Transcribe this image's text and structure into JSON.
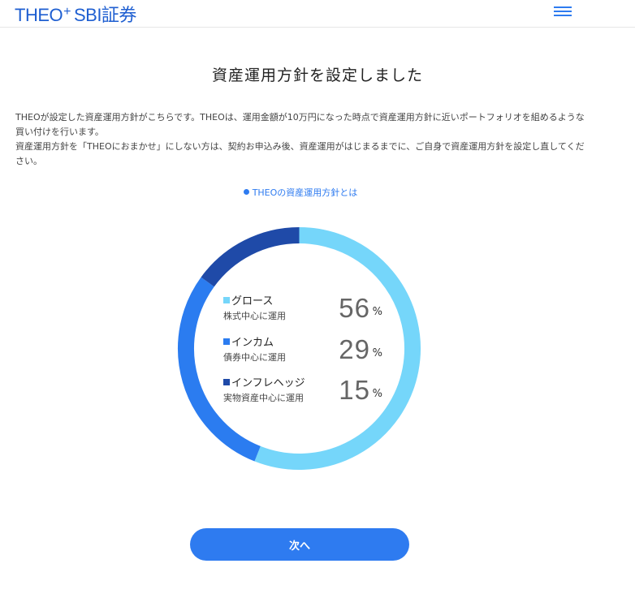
{
  "header": {
    "logo_main": "THEO",
    "logo_plus": "+",
    "logo_sub": "SBI証券",
    "menu_icon": "hamburger-menu-icon"
  },
  "main": {
    "title": "資産運用方針を設定しました",
    "description_lines": [
      "THEOが設定した資産運用方針がこちらです。THEOは、運用金額が10万円になった時点で資産運用方針に近いポートフォリオを組めるような買い付けを行います。",
      "資産運用方針を「THEOにおまかせ」にしない方は、契約お申込み後、資産運用がはじまるまでに、ご自身で資産運用方針を設定し直してください。"
    ],
    "policy_link": "THEOの資産運用方針とは",
    "next_button": "次へ"
  },
  "colors": {
    "brand": "#1f5fd1",
    "accent": "#2e7bf0",
    "growth": "#75d6fa",
    "income": "#2b7cf0",
    "inflation_hedge": "#1f4aa8"
  },
  "chart_data": {
    "type": "pie",
    "series": [
      {
        "name": "グロース",
        "description": "株式中心に運用",
        "value": 56,
        "color": "#75d6fa"
      },
      {
        "name": "インカム",
        "description": "債券中心に運用",
        "value": 29,
        "color": "#2b7cf0"
      },
      {
        "name": "インフレヘッジ",
        "description": "実物資産中心に運用",
        "value": 15,
        "color": "#1f4aa8"
      }
    ],
    "unit": "%"
  }
}
